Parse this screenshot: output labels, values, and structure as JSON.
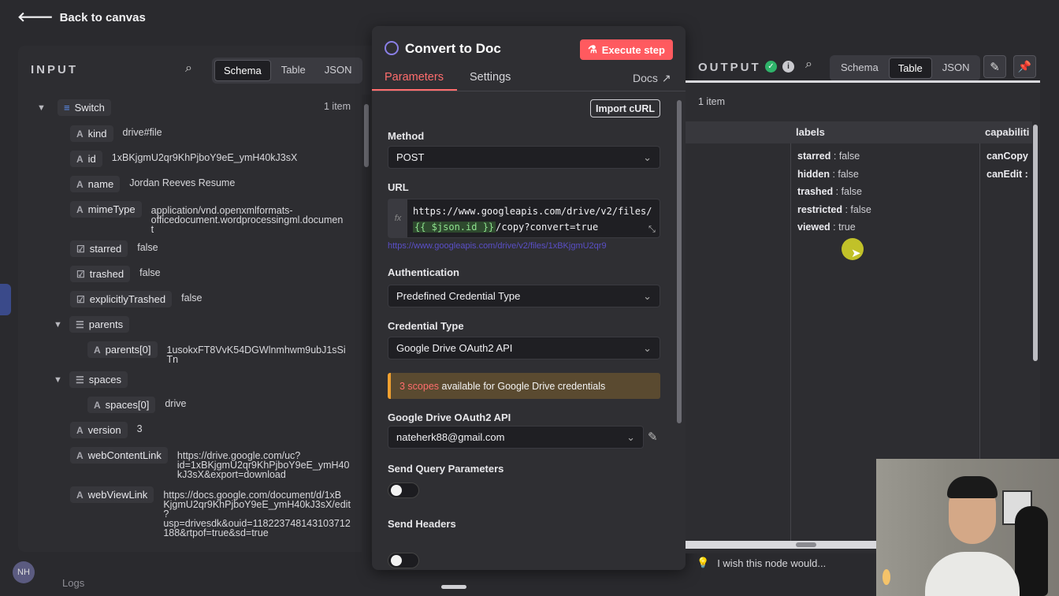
{
  "back": {
    "label": "Back to canvas"
  },
  "input": {
    "title": "INPUT",
    "views": [
      "Schema",
      "Table",
      "JSON"
    ],
    "active_view": "Schema",
    "root": {
      "name": "Switch",
      "count": "1 item"
    },
    "fields": [
      {
        "type": "A",
        "key": "kind",
        "value": "drive#file"
      },
      {
        "type": "A",
        "key": "id",
        "value": "1xBKjgmU2qr9KhPjboY9eE_ymH40kJ3sX"
      },
      {
        "type": "A",
        "key": "name",
        "value": "Jordan Reeves Resume"
      },
      {
        "type": "A",
        "key": "mimeType",
        "value_lines": [
          "application/vnd.openxmlformats-",
          "officedocument.wordprocessingml.documen",
          "t"
        ]
      },
      {
        "type": "☑",
        "key": "starred",
        "value": "false"
      },
      {
        "type": "☑",
        "key": "trashed",
        "value": "false"
      },
      {
        "type": "☑",
        "key": "explicitlyTrashed",
        "value": "false"
      },
      {
        "type": "☰",
        "key": "parents"
      },
      {
        "type": "A",
        "key": "parents[0]",
        "value_lines": [
          "1usokxFT8VvK54DGWlnmhwm9ubJ1sSi",
          "Tn"
        ]
      },
      {
        "type": "☰",
        "key": "spaces"
      },
      {
        "type": "A",
        "key": "spaces[0]",
        "value": "drive"
      },
      {
        "type": "A",
        "key": "version",
        "value": "3"
      },
      {
        "type": "A",
        "key": "webContentLink",
        "value_lines": [
          "https://drive.google.com/uc?",
          "id=1xBKjgmU2qr9KhPjboY9eE_ymH40",
          "kJ3sX&export=download"
        ]
      },
      {
        "type": "A",
        "key": "webViewLink",
        "value_lines": [
          "https://docs.google.com/document/d/1xB",
          "KjgmU2qr9KhPjboY9eE_ymH40kJ3sX/edit",
          "?",
          "usp=drivesdk&ouid=118223748143103712",
          "188&rtpof=true&sd=true"
        ]
      }
    ]
  },
  "node": {
    "title": "Convert to Doc",
    "execute_label": "Execute step",
    "tabs": [
      "Parameters",
      "Settings"
    ],
    "docs_label": "Docs",
    "import_label": "Import cURL",
    "method": {
      "label": "Method",
      "value": "POST"
    },
    "url": {
      "label": "URL",
      "line1": "https://www.googleapis.com/drive/v2/files/",
      "expr": "{{ $json.id }}",
      "line2_rest": "/copy?convert=true",
      "preview": "https://www.googleapis.com/drive/v2/files/1xBKjgmU2qr9"
    },
    "auth": {
      "label": "Authentication",
      "value": "Predefined Credential Type"
    },
    "cred_type": {
      "label": "Credential Type",
      "value": "Google Drive OAuth2 API"
    },
    "notice": {
      "scopes": "3 scopes",
      "rest": " available for Google Drive credentials"
    },
    "account": {
      "label": "Google Drive OAuth2 API",
      "value": "nateherk88@gmail.com"
    },
    "send_query": {
      "label": "Send Query Parameters"
    },
    "send_headers": {
      "label": "Send Headers"
    }
  },
  "output": {
    "title": "OUTPUT",
    "views": [
      "Schema",
      "Table",
      "JSON"
    ],
    "active_view": "Table",
    "count": "1 item",
    "columns": [
      "labels",
      "capabiliti"
    ],
    "labels": [
      {
        "k": "starred",
        "v": "false"
      },
      {
        "k": "hidden",
        "v": "false"
      },
      {
        "k": "trashed",
        "v": "false"
      },
      {
        "k": "restricted",
        "v": "false"
      },
      {
        "k": "viewed",
        "v": "true"
      }
    ],
    "capabilities": [
      "canCopy",
      "canEdit :"
    ]
  },
  "feedback": {
    "label": "I wish this node would..."
  },
  "footer": {
    "logs": "Logs",
    "avatar": "NH"
  }
}
